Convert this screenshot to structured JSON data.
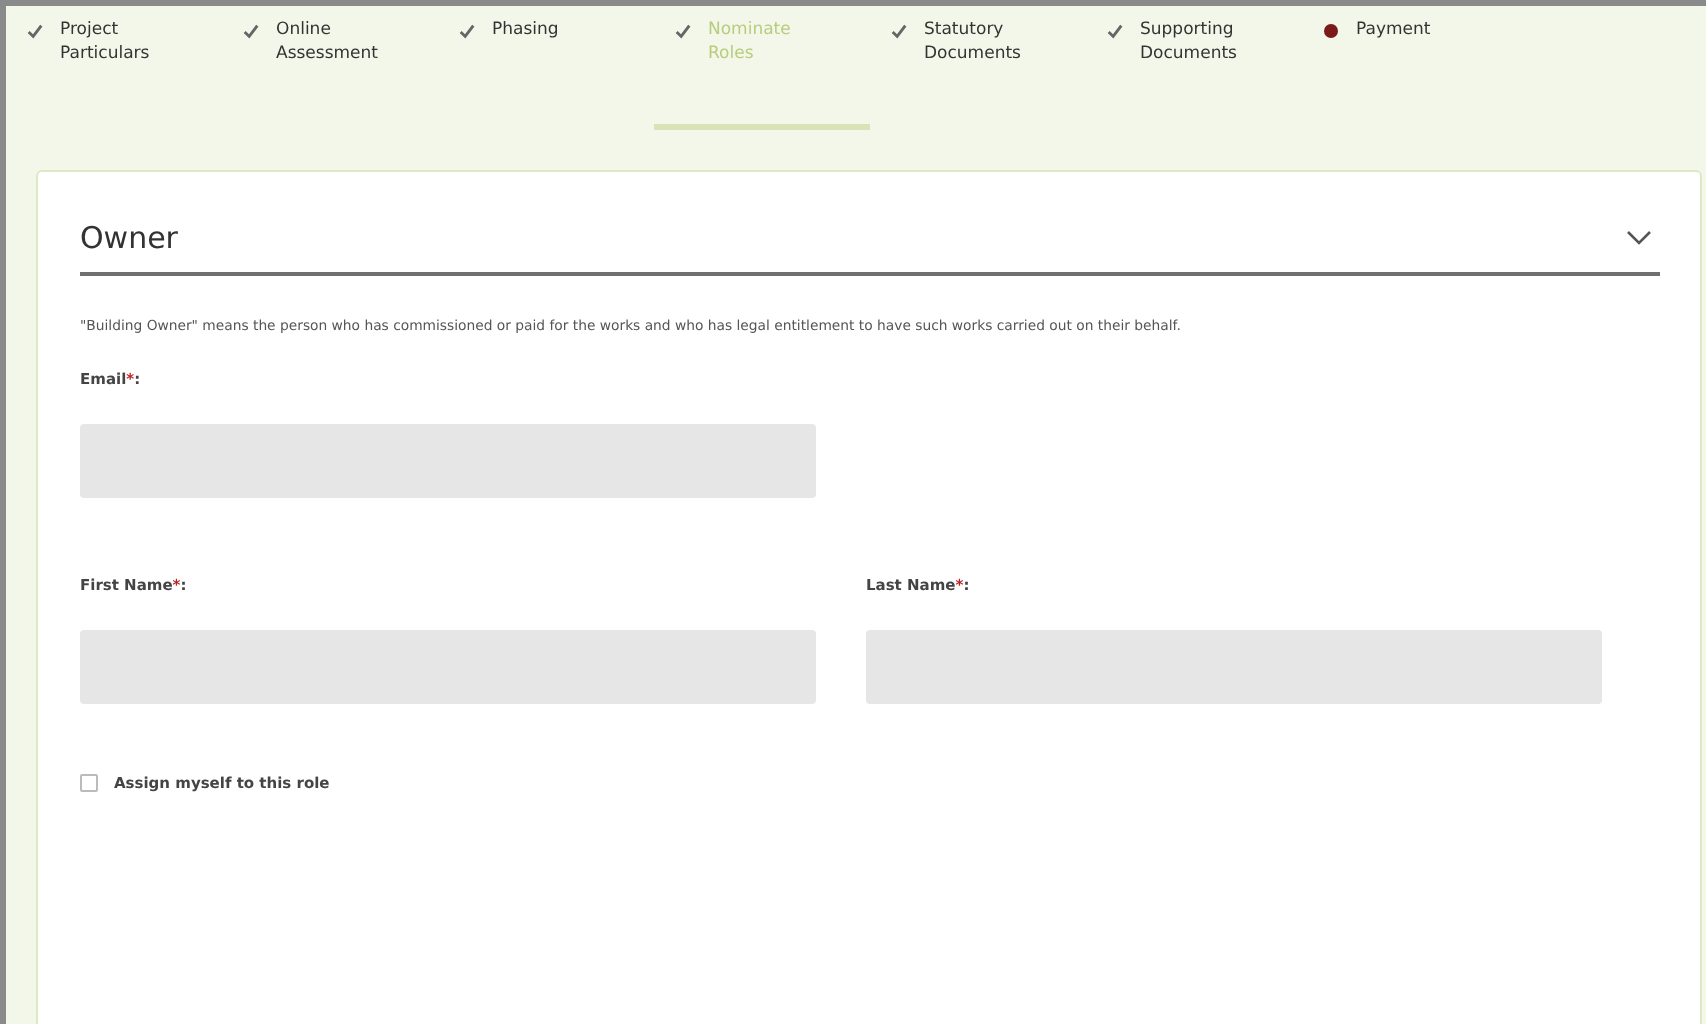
{
  "steps": [
    {
      "label": "Project Particulars",
      "completed": true,
      "selected": false
    },
    {
      "label": "Online Assessment",
      "completed": true,
      "selected": false
    },
    {
      "label": "Phasing",
      "completed": true,
      "selected": false
    },
    {
      "label": "Nominate Roles",
      "completed": true,
      "selected": true
    },
    {
      "label": "Statutory Documents",
      "completed": true,
      "selected": false
    },
    {
      "label": "Supporting Documents",
      "completed": true,
      "selected": false
    },
    {
      "label": "Payment",
      "completed": false,
      "selected": false
    }
  ],
  "section": {
    "title": "Owner",
    "expanded": true,
    "description": "\"Building Owner\" means the person who has commissioned or paid for the works and who has legal entitlement to have such works carried out on their behalf.",
    "field_rows": [
      [
        {
          "label": "Email",
          "required_mark": "*",
          "suffix": ":"
        }
      ],
      [
        {
          "label": "First Name",
          "required_mark": "*",
          "suffix": ":"
        },
        {
          "label": "Last Name",
          "required_mark": "*",
          "suffix": ":"
        }
      ]
    ],
    "checkbox": {
      "label": "Assign myself to this role",
      "checked": false
    }
  }
}
